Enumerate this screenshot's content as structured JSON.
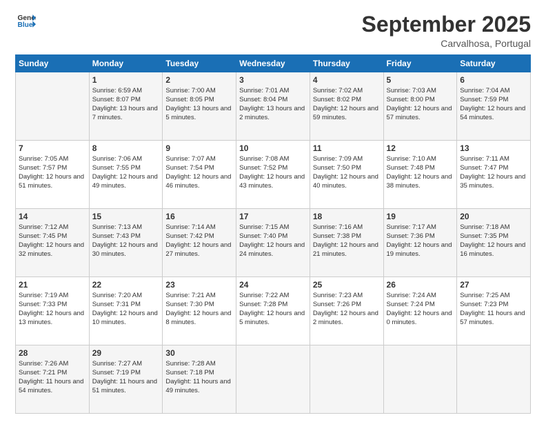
{
  "header": {
    "logo_line1": "General",
    "logo_line2": "Blue",
    "month": "September 2025",
    "location": "Carvalhosa, Portugal"
  },
  "days": [
    "Sunday",
    "Monday",
    "Tuesday",
    "Wednesday",
    "Thursday",
    "Friday",
    "Saturday"
  ],
  "weeks": [
    [
      {
        "num": "",
        "sunrise": "",
        "sunset": "",
        "daylight": ""
      },
      {
        "num": "1",
        "sunrise": "Sunrise: 6:59 AM",
        "sunset": "Sunset: 8:07 PM",
        "daylight": "Daylight: 13 hours and 7 minutes."
      },
      {
        "num": "2",
        "sunrise": "Sunrise: 7:00 AM",
        "sunset": "Sunset: 8:05 PM",
        "daylight": "Daylight: 13 hours and 5 minutes."
      },
      {
        "num": "3",
        "sunrise": "Sunrise: 7:01 AM",
        "sunset": "Sunset: 8:04 PM",
        "daylight": "Daylight: 13 hours and 2 minutes."
      },
      {
        "num": "4",
        "sunrise": "Sunrise: 7:02 AM",
        "sunset": "Sunset: 8:02 PM",
        "daylight": "Daylight: 12 hours and 59 minutes."
      },
      {
        "num": "5",
        "sunrise": "Sunrise: 7:03 AM",
        "sunset": "Sunset: 8:00 PM",
        "daylight": "Daylight: 12 hours and 57 minutes."
      },
      {
        "num": "6",
        "sunrise": "Sunrise: 7:04 AM",
        "sunset": "Sunset: 7:59 PM",
        "daylight": "Daylight: 12 hours and 54 minutes."
      }
    ],
    [
      {
        "num": "7",
        "sunrise": "Sunrise: 7:05 AM",
        "sunset": "Sunset: 7:57 PM",
        "daylight": "Daylight: 12 hours and 51 minutes."
      },
      {
        "num": "8",
        "sunrise": "Sunrise: 7:06 AM",
        "sunset": "Sunset: 7:55 PM",
        "daylight": "Daylight: 12 hours and 49 minutes."
      },
      {
        "num": "9",
        "sunrise": "Sunrise: 7:07 AM",
        "sunset": "Sunset: 7:54 PM",
        "daylight": "Daylight: 12 hours and 46 minutes."
      },
      {
        "num": "10",
        "sunrise": "Sunrise: 7:08 AM",
        "sunset": "Sunset: 7:52 PM",
        "daylight": "Daylight: 12 hours and 43 minutes."
      },
      {
        "num": "11",
        "sunrise": "Sunrise: 7:09 AM",
        "sunset": "Sunset: 7:50 PM",
        "daylight": "Daylight: 12 hours and 40 minutes."
      },
      {
        "num": "12",
        "sunrise": "Sunrise: 7:10 AM",
        "sunset": "Sunset: 7:48 PM",
        "daylight": "Daylight: 12 hours and 38 minutes."
      },
      {
        "num": "13",
        "sunrise": "Sunrise: 7:11 AM",
        "sunset": "Sunset: 7:47 PM",
        "daylight": "Daylight: 12 hours and 35 minutes."
      }
    ],
    [
      {
        "num": "14",
        "sunrise": "Sunrise: 7:12 AM",
        "sunset": "Sunset: 7:45 PM",
        "daylight": "Daylight: 12 hours and 32 minutes."
      },
      {
        "num": "15",
        "sunrise": "Sunrise: 7:13 AM",
        "sunset": "Sunset: 7:43 PM",
        "daylight": "Daylight: 12 hours and 30 minutes."
      },
      {
        "num": "16",
        "sunrise": "Sunrise: 7:14 AM",
        "sunset": "Sunset: 7:42 PM",
        "daylight": "Daylight: 12 hours and 27 minutes."
      },
      {
        "num": "17",
        "sunrise": "Sunrise: 7:15 AM",
        "sunset": "Sunset: 7:40 PM",
        "daylight": "Daylight: 12 hours and 24 minutes."
      },
      {
        "num": "18",
        "sunrise": "Sunrise: 7:16 AM",
        "sunset": "Sunset: 7:38 PM",
        "daylight": "Daylight: 12 hours and 21 minutes."
      },
      {
        "num": "19",
        "sunrise": "Sunrise: 7:17 AM",
        "sunset": "Sunset: 7:36 PM",
        "daylight": "Daylight: 12 hours and 19 minutes."
      },
      {
        "num": "20",
        "sunrise": "Sunrise: 7:18 AM",
        "sunset": "Sunset: 7:35 PM",
        "daylight": "Daylight: 12 hours and 16 minutes."
      }
    ],
    [
      {
        "num": "21",
        "sunrise": "Sunrise: 7:19 AM",
        "sunset": "Sunset: 7:33 PM",
        "daylight": "Daylight: 12 hours and 13 minutes."
      },
      {
        "num": "22",
        "sunrise": "Sunrise: 7:20 AM",
        "sunset": "Sunset: 7:31 PM",
        "daylight": "Daylight: 12 hours and 10 minutes."
      },
      {
        "num": "23",
        "sunrise": "Sunrise: 7:21 AM",
        "sunset": "Sunset: 7:30 PM",
        "daylight": "Daylight: 12 hours and 8 minutes."
      },
      {
        "num": "24",
        "sunrise": "Sunrise: 7:22 AM",
        "sunset": "Sunset: 7:28 PM",
        "daylight": "Daylight: 12 hours and 5 minutes."
      },
      {
        "num": "25",
        "sunrise": "Sunrise: 7:23 AM",
        "sunset": "Sunset: 7:26 PM",
        "daylight": "Daylight: 12 hours and 2 minutes."
      },
      {
        "num": "26",
        "sunrise": "Sunrise: 7:24 AM",
        "sunset": "Sunset: 7:24 PM",
        "daylight": "Daylight: 12 hours and 0 minutes."
      },
      {
        "num": "27",
        "sunrise": "Sunrise: 7:25 AM",
        "sunset": "Sunset: 7:23 PM",
        "daylight": "Daylight: 11 hours and 57 minutes."
      }
    ],
    [
      {
        "num": "28",
        "sunrise": "Sunrise: 7:26 AM",
        "sunset": "Sunset: 7:21 PM",
        "daylight": "Daylight: 11 hours and 54 minutes."
      },
      {
        "num": "29",
        "sunrise": "Sunrise: 7:27 AM",
        "sunset": "Sunset: 7:19 PM",
        "daylight": "Daylight: 11 hours and 51 minutes."
      },
      {
        "num": "30",
        "sunrise": "Sunrise: 7:28 AM",
        "sunset": "Sunset: 7:18 PM",
        "daylight": "Daylight: 11 hours and 49 minutes."
      },
      {
        "num": "",
        "sunrise": "",
        "sunset": "",
        "daylight": ""
      },
      {
        "num": "",
        "sunrise": "",
        "sunset": "",
        "daylight": ""
      },
      {
        "num": "",
        "sunrise": "",
        "sunset": "",
        "daylight": ""
      },
      {
        "num": "",
        "sunrise": "",
        "sunset": "",
        "daylight": ""
      }
    ]
  ]
}
